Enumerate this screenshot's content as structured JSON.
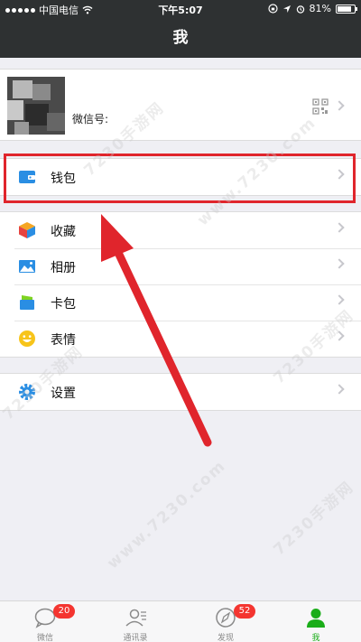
{
  "statusbar": {
    "carrier": "中国电信",
    "time": "下午5:07",
    "battery": "81%",
    "battery_level": 0.81
  },
  "navbar": {
    "title": "我"
  },
  "profile": {
    "wechat_id_label": "微信号:"
  },
  "menu": {
    "wallet": "钱包",
    "favorites": "收藏",
    "album": "相册",
    "cards": "卡包",
    "stickers": "表情",
    "settings": "设置"
  },
  "tabbar": {
    "chats": {
      "label": "微信",
      "badge": "20"
    },
    "contacts": {
      "label": "通讯录"
    },
    "discover": {
      "label": "发现",
      "badge": "52"
    },
    "me": {
      "label": "我"
    }
  },
  "watermark": {
    "text1": "7230手游网",
    "text2": "www.7230.com"
  },
  "colors": {
    "navbar": "#2e3132",
    "highlight": "#e0252c",
    "active_tab": "#1aad19",
    "badge": "#f43530"
  }
}
